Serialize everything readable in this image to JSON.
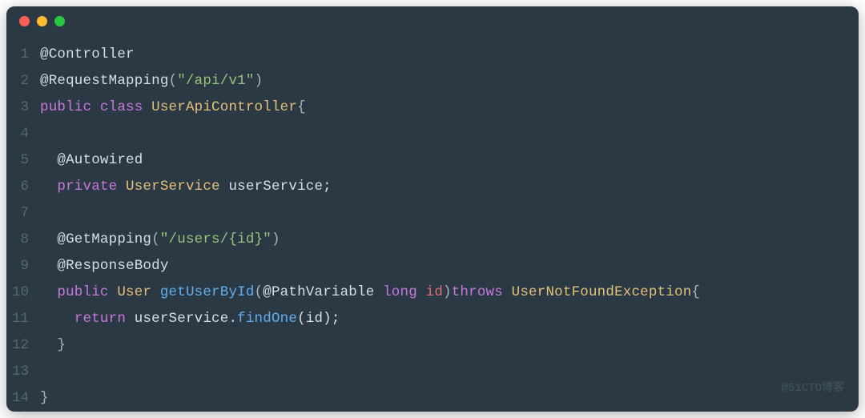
{
  "titlebar": {
    "buttons": [
      "close",
      "minimize",
      "zoom"
    ]
  },
  "code": {
    "lines": [
      {
        "num": "1",
        "tokens": [
          {
            "t": "@Controller",
            "c": "annotation"
          }
        ]
      },
      {
        "num": "2",
        "tokens": [
          {
            "t": "@RequestMapping",
            "c": "annotation"
          },
          {
            "t": "(",
            "c": "punc"
          },
          {
            "t": "\"/api/v1\"",
            "c": "string"
          },
          {
            "t": ")",
            "c": "punc"
          }
        ]
      },
      {
        "num": "3",
        "tokens": [
          {
            "t": "public",
            "c": "keyword"
          },
          {
            "t": " ",
            "c": "punc"
          },
          {
            "t": "class",
            "c": "keyword"
          },
          {
            "t": " ",
            "c": "punc"
          },
          {
            "t": "UserApiController",
            "c": "type"
          },
          {
            "t": "{",
            "c": "punc"
          }
        ]
      },
      {
        "num": "4",
        "tokens": []
      },
      {
        "num": "5",
        "tokens": [
          {
            "t": "  ",
            "c": "punc"
          },
          {
            "t": "@Autowired",
            "c": "annotation"
          }
        ]
      },
      {
        "num": "6",
        "tokens": [
          {
            "t": "  ",
            "c": "punc"
          },
          {
            "t": "private",
            "c": "keyword"
          },
          {
            "t": " ",
            "c": "punc"
          },
          {
            "t": "UserService",
            "c": "type"
          },
          {
            "t": " userService;",
            "c": "identifier"
          }
        ]
      },
      {
        "num": "7",
        "tokens": []
      },
      {
        "num": "8",
        "tokens": [
          {
            "t": "  ",
            "c": "punc"
          },
          {
            "t": "@GetMapping",
            "c": "annotation"
          },
          {
            "t": "(",
            "c": "punc"
          },
          {
            "t": "\"/users/{id}\"",
            "c": "string"
          },
          {
            "t": ")",
            "c": "punc"
          }
        ]
      },
      {
        "num": "9",
        "tokens": [
          {
            "t": "  ",
            "c": "punc"
          },
          {
            "t": "@ResponseBody",
            "c": "annotation"
          }
        ]
      },
      {
        "num": "10",
        "tokens": [
          {
            "t": "  ",
            "c": "punc"
          },
          {
            "t": "public",
            "c": "keyword"
          },
          {
            "t": " ",
            "c": "punc"
          },
          {
            "t": "User",
            "c": "type"
          },
          {
            "t": " ",
            "c": "punc"
          },
          {
            "t": "getUserById",
            "c": "method"
          },
          {
            "t": "(",
            "c": "punc"
          },
          {
            "t": "@PathVariable",
            "c": "annotation"
          },
          {
            "t": " ",
            "c": "punc"
          },
          {
            "t": "long",
            "c": "keyword"
          },
          {
            "t": " ",
            "c": "punc"
          },
          {
            "t": "id",
            "c": "param"
          },
          {
            "t": ")",
            "c": "punc"
          },
          {
            "t": "throws",
            "c": "keyword"
          },
          {
            "t": " ",
            "c": "punc"
          },
          {
            "t": "UserNotFoundException",
            "c": "type"
          },
          {
            "t": "{",
            "c": "punc"
          }
        ]
      },
      {
        "num": "11",
        "tokens": [
          {
            "t": "    ",
            "c": "punc"
          },
          {
            "t": "return",
            "c": "keyword"
          },
          {
            "t": " userService.",
            "c": "identifier"
          },
          {
            "t": "findOne",
            "c": "method"
          },
          {
            "t": "(id);",
            "c": "identifier"
          }
        ]
      },
      {
        "num": "12",
        "tokens": [
          {
            "t": "  }",
            "c": "punc"
          }
        ]
      },
      {
        "num": "13",
        "tokens": []
      },
      {
        "num": "14",
        "tokens": [
          {
            "t": "}",
            "c": "punc"
          }
        ]
      }
    ]
  },
  "watermark": "@51CTO博客"
}
